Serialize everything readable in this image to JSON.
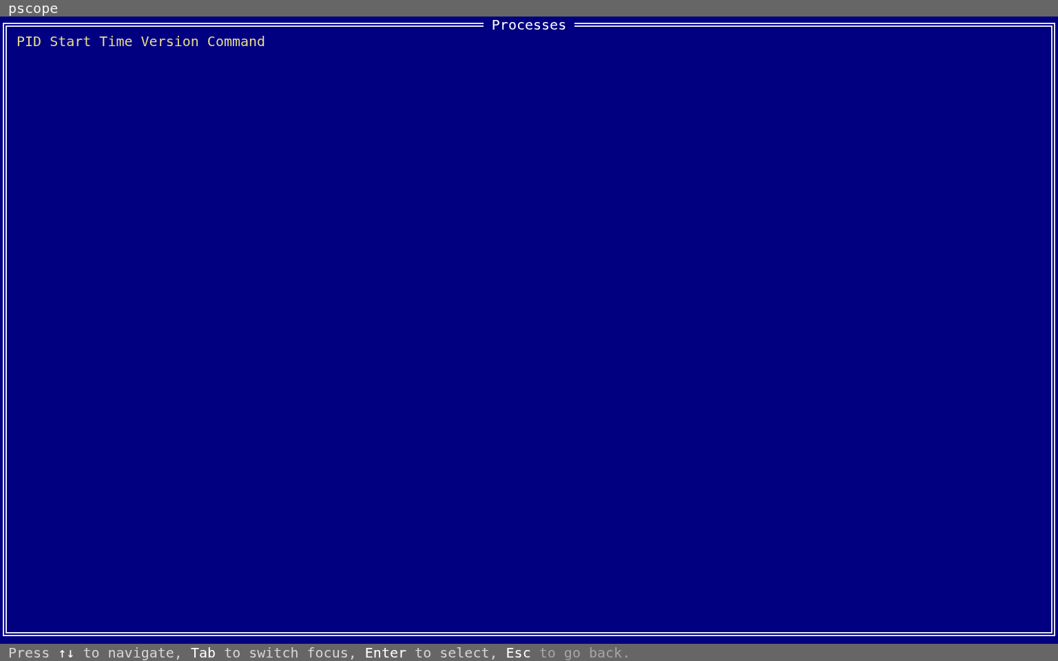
{
  "window": {
    "title": "pscope"
  },
  "panel": {
    "title": "Processes",
    "table": {
      "columns": [
        "PID",
        "Start Time",
        "Version",
        "Command"
      ]
    }
  },
  "status_bar": {
    "segments": [
      {
        "text": "Press",
        "kind": "text"
      },
      {
        "text": "↑↓",
        "kind": "key"
      },
      {
        "text": "to navigate,",
        "kind": "text"
      },
      {
        "text": "Tab",
        "kind": "key"
      },
      {
        "text": "to switch focus,",
        "kind": "text"
      },
      {
        "text": "Enter",
        "kind": "key"
      },
      {
        "text": "to select,",
        "kind": "text"
      },
      {
        "text": "Esc",
        "kind": "key"
      },
      {
        "text": "to go back.",
        "kind": "dim"
      }
    ]
  }
}
